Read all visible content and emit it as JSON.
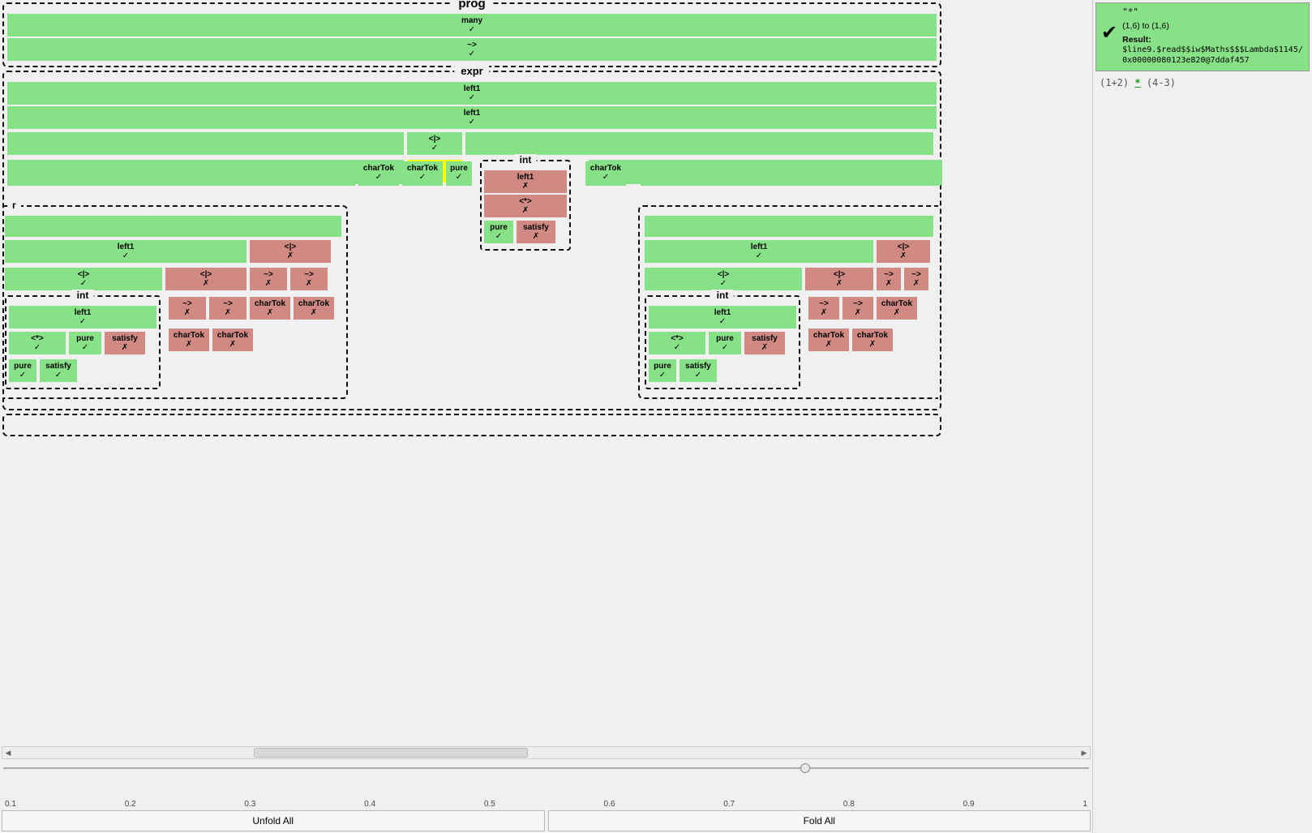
{
  "marks": {
    "ok": "✓",
    "fail": "✗"
  },
  "groups": {
    "prog": "prog",
    "expr": "expr",
    "int": "int",
    "r_label": "r"
  },
  "prog": {
    "many": "many",
    "tilde": "~>"
  },
  "expr": {
    "left1_a": "left1",
    "left1_b": "left1",
    "alt": "<|>",
    "tilde": "~>",
    "row5_wide_left": "",
    "charTok_a": "charTok",
    "charTok_b": "charTok",
    "pure": "pure",
    "charTok_c": "charTok"
  },
  "int_mid": {
    "left1": "left1",
    "star": "<*>",
    "pure": "pure",
    "satisfy": "satisfy"
  },
  "left_panel": {
    "left1": "left1",
    "alt_top": "<|>",
    "alt_fail": "<|>",
    "alt_fail2": "<|>",
    "tilde_f1": "~>",
    "tilde_f2": "~>",
    "tilde_f3": "~>",
    "tilde_f4": "~>",
    "charTok_f1": "charTok",
    "charTok_f2": "charTok",
    "charTok_f3": "charTok",
    "charTok_f4": "charTok",
    "int_group": {
      "left1": "left1",
      "star": "<*>",
      "pure_ok": "pure",
      "satisfy_f": "satisfy",
      "pure2": "pure",
      "satisfy2": "satisfy"
    }
  },
  "right_panel": {
    "left1": "left1",
    "alt_top": "<|>",
    "alt_fail": "<|>",
    "tilde_f": "~>",
    "tilde_f1": "~>",
    "tilde_f2": "~>",
    "charTok_f": "charTok",
    "charTok_f1": "charTok",
    "charTok_f2": "charTok",
    "int_group": {
      "left1": "left1",
      "star": "<*>",
      "pure_ok": "pure",
      "satisfy_f": "satisfy",
      "pure2": "pure",
      "satisfy2": "satisfy"
    }
  },
  "zoom": {
    "ticks": [
      "0.1",
      "0.2",
      "0.3",
      "0.4",
      "0.5",
      "0.6",
      "0.7",
      "0.8",
      "0.9",
      "1"
    ]
  },
  "buttons": {
    "unfold": "Unfold All",
    "fold": "Fold All"
  },
  "sidebar": {
    "node_title": "\"*\"",
    "range": "(1,6) to (1,6)",
    "result_label": "Result:",
    "result_value": "$line9.$read$$iw$Maths$$$Lambda$1145/0x00000080123e820@7ddaf457",
    "code": {
      "pre": "(1+2)",
      "hl": "*",
      "post": "(4-3)"
    }
  }
}
